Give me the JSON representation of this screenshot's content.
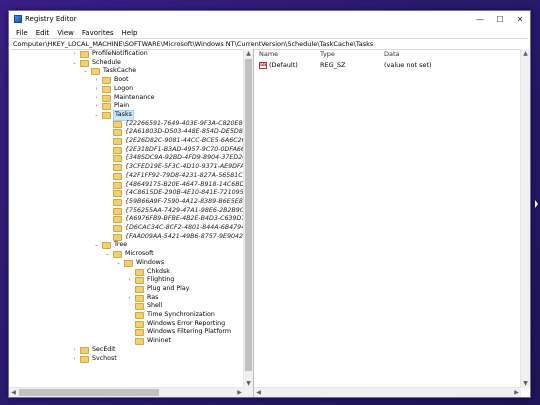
{
  "window": {
    "title": "Registry Editor",
    "controls": {
      "minimize": "—",
      "maximize": "☐",
      "close": "✕"
    }
  },
  "menu": [
    "File",
    "Edit",
    "View",
    "Favorites",
    "Help"
  ],
  "address": "Computer\\HKEY_LOCAL_MACHINE\\SOFTWARE\\Microsoft\\Windows NT\\CurrentVersion\\Schedule\\TaskCache\\Tasks",
  "tree": [
    {
      "label": "ProfileNotification",
      "level": 0,
      "exp": ">"
    },
    {
      "label": "Schedule",
      "level": 0,
      "exp": "v"
    },
    {
      "label": "TaskCache",
      "level": 1,
      "exp": "v"
    },
    {
      "label": "Boot",
      "level": 2,
      "exp": ">"
    },
    {
      "label": "Logon",
      "level": 2,
      "exp": ">"
    },
    {
      "label": "Maintenance",
      "level": 2,
      "exp": ">"
    },
    {
      "label": "Plain",
      "level": 2,
      "exp": ">"
    },
    {
      "label": "Tasks",
      "level": 2,
      "exp": "v",
      "selected": true
    },
    {
      "label": "{22266591-7649-403E-9F3A-C820E8C1126D}",
      "level": 3,
      "guid": true
    },
    {
      "label": "{2A61803D-D503-448E-854D-DE5D838EFA1B}",
      "level": 3,
      "guid": true
    },
    {
      "label": "{2E26D82C-9081-44CC-BCE5-6A6C2602E432}",
      "level": 3,
      "guid": true
    },
    {
      "label": "{2E318DF1-B3AD-4957-9C70-0DFA66F909E4}",
      "level": 3,
      "guid": true
    },
    {
      "label": "{348SDC9A-92BD-4FD9-8904-37ED2C947BDE}",
      "level": 3,
      "guid": true
    },
    {
      "label": "{3CFED19E-5F3C-4D10-9371-AE9DFAF34B5D}",
      "level": 3,
      "guid": true
    },
    {
      "label": "{42F1FF92-79D8-4231-827A-56581C51A1B8}",
      "level": 3,
      "guid": true
    },
    {
      "label": "{48649175-B20E-4647-B918-14C6BDA91009}",
      "level": 3,
      "guid": true
    },
    {
      "label": "{4C8615DE-290B-4E10-841E-72109506E2B}",
      "level": 3,
      "guid": true
    },
    {
      "label": "{59B66A9F-7590-4A12-8389-B6E5E89DCDD7}",
      "level": 3,
      "guid": true
    },
    {
      "label": "{756255AA-7429-47A1-98E6-2B2B9CD0864}",
      "level": 3,
      "guid": true
    },
    {
      "label": "{A6976FB9-BFBE-4B2E-B4D3-C639D7DA7B21}",
      "level": 3,
      "guid": true
    },
    {
      "label": "{D6CAC34C-8CF2-4801-844A-6B4794293261}",
      "level": 3,
      "guid": true
    },
    {
      "label": "{FAA009AA-5421-49B6-8757-9E9042F8A8B8}",
      "level": 3,
      "guid": true
    },
    {
      "label": "Tree",
      "level": 2,
      "exp": "v"
    },
    {
      "label": "Microsoft",
      "level": 3,
      "exp": "v"
    },
    {
      "label": "Windows",
      "level": 4,
      "exp": "v"
    },
    {
      "label": "Chkdsk",
      "level": 5
    },
    {
      "label": "Flighting",
      "level": 5,
      "exp": ">"
    },
    {
      "label": "Plug and Play",
      "level": 5
    },
    {
      "label": "Ras",
      "level": 5,
      "exp": ">"
    },
    {
      "label": "Shell",
      "level": 5
    },
    {
      "label": "Time Synchronization",
      "level": 5
    },
    {
      "label": "Windows Error Reporting",
      "level": 5
    },
    {
      "label": "Windows Filtering Platform",
      "level": 5
    },
    {
      "label": "Wininet",
      "level": 5
    },
    {
      "label": "SecEdit",
      "level": 0,
      "exp": ">"
    },
    {
      "label": "Svchost",
      "level": 0,
      "exp": ">"
    }
  ],
  "list": {
    "headers": {
      "name": "Name",
      "type": "Type",
      "data": "Data"
    },
    "rows": [
      {
        "name": "(Default)",
        "type": "REG_SZ",
        "data": "(value not set)"
      }
    ]
  },
  "icons": {
    "value_type": "ab"
  }
}
